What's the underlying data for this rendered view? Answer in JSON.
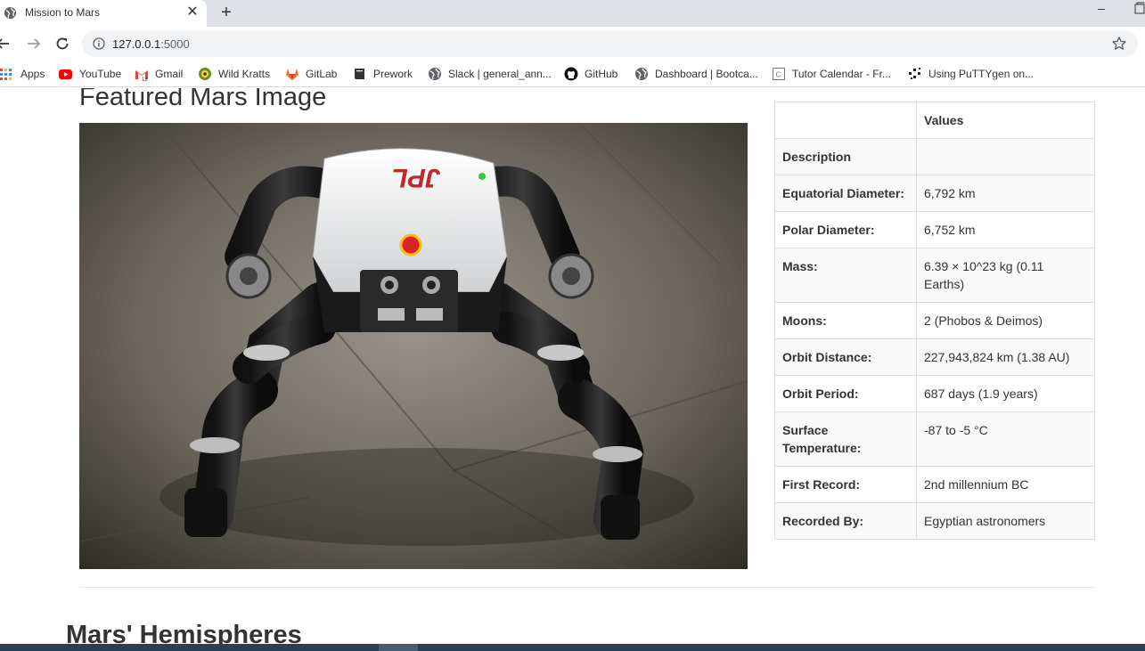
{
  "browser": {
    "tab": {
      "title": "Mission to Mars",
      "close_icon": "close-icon",
      "favicon": "globe-icon"
    },
    "new_tab_symbol": "+",
    "address": {
      "host": "127.0.0.1",
      "port": ":5000"
    },
    "bookmarks": [
      {
        "label": "Apps",
        "icon": "apps-grid-icon"
      },
      {
        "label": "YouTube",
        "icon": "youtube-icon"
      },
      {
        "label": "Gmail",
        "icon": "gmail-icon"
      },
      {
        "label": "Wild Kratts",
        "icon": "wild-kratts-icon"
      },
      {
        "label": "GitLab",
        "icon": "gitlab-icon"
      },
      {
        "label": "Prework",
        "icon": "book-icon"
      },
      {
        "label": "Slack | general_ann...",
        "icon": "globe-icon"
      },
      {
        "label": "GitHub",
        "icon": "github-icon"
      },
      {
        "label": "Dashboard | Bootca...",
        "icon": "globe-icon"
      },
      {
        "label": "Tutor Calendar - Fr...",
        "icon": "calendar-icon"
      },
      {
        "label": "Using PuTTYgen on...",
        "icon": "putty-icon"
      }
    ]
  },
  "page": {
    "featured_heading": "Featured Mars Image",
    "facts_table": {
      "header": [
        "",
        "Values"
      ],
      "rows": [
        {
          "label": "Description",
          "value": ""
        },
        {
          "label": "Equatorial Diameter:",
          "value": "6,792 km"
        },
        {
          "label": "Polar Diameter:",
          "value": "6,752 km"
        },
        {
          "label": "Mass:",
          "value": "6.39 × 10^23 kg (0.11 Earths)"
        },
        {
          "label": "Moons:",
          "value": "2 (Phobos & Deimos)"
        },
        {
          "label": "Orbit Distance:",
          "value": "227,943,824 km (1.38 AU)"
        },
        {
          "label": "Orbit Period:",
          "value": "687 days (1.9 years)"
        },
        {
          "label": "Surface Temperature:",
          "value": "-87 to -5 °C"
        },
        {
          "label": "First Record:",
          "value": "2nd millennium BC"
        },
        {
          "label": "Recorded By:",
          "value": "Egyptian astronomers"
        }
      ]
    },
    "robot_logo_text": "JPL",
    "hemispheres_heading": "Mars' Hemispheres"
  }
}
